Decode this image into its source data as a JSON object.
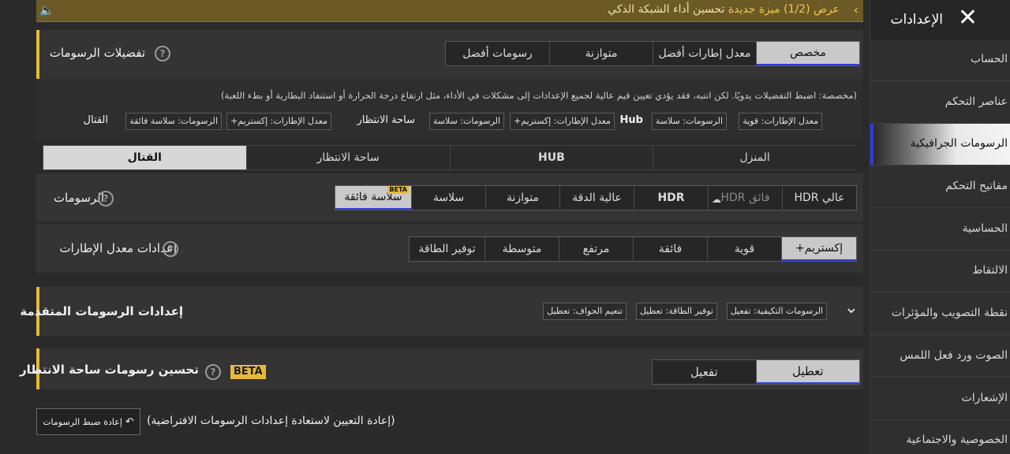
{
  "notice": {
    "speaker_icon": "speaker-icon",
    "text_gold": "عرض (1/2)  ميزة جديدة",
    "text": "تحسين أداء الشبكة الذكي",
    "chevron_icon": "chevron-left-icon"
  },
  "sidebar": {
    "title": "الإعدادات",
    "close_icon": "close-icon",
    "items": [
      {
        "label": "الحساب"
      },
      {
        "label": "عناصر التحكم"
      },
      {
        "label": "الرسومات الجرافيكية"
      },
      {
        "label": "مفاتيح التحكم"
      },
      {
        "label": "الحساسية"
      },
      {
        "label": "الالتقاط"
      },
      {
        "label": "نقطة التصويب والمؤثرات"
      },
      {
        "label": "الصوت ورد فعل اللمس"
      },
      {
        "label": "الإشعارات"
      },
      {
        "label": "الخصوصية والاجتماعية"
      }
    ],
    "active_index": 2
  },
  "prefs": {
    "title": "تفضيلات الرسومات",
    "options": [
      "مخصص",
      "معدل إطارات أفضل",
      "متوازنة",
      "رسومات أفضل"
    ],
    "selected": 0,
    "note": "(مخصصة: اضبط التفضيلات يدويًا. لكن انتبه، فقد يؤدي تعيين قيم عالية لجميع الإعدادات إلى مشكلات في الأداء، مثل ارتفاع درجة الحرارة أو استنفاد البطارية أو بطء اللعبة)",
    "summary": {
      "hub_label": "Hub",
      "hub_fps": "معدل الإطارات: قوية",
      "hub_gfx": "الرسومات: سلاسة",
      "lobby_label": "ساحة الانتظار",
      "lobby_fps": "معدل الإطارات: إكستريم+",
      "lobby_gfx": "الرسومات: سلاسة",
      "combat_label": "القتال",
      "combat_fps": "معدل الإطارات: إكستريم+",
      "combat_gfx": "الرسومات: سلاسة فائقة"
    }
  },
  "mode_tabs": [
    "المنزل",
    "HUB",
    "ساحة الانتظار",
    "القتال"
  ],
  "mode_selected": 3,
  "graphics": {
    "title": "الرسومات",
    "options": [
      "عالي HDR",
      "فائق HDR",
      "HDR",
      "عالية الدقة",
      "متوازنة",
      "سلاسة",
      "سلاسة فائقة"
    ],
    "selected": 6,
    "beta_tag": "BETA",
    "hdr_cloud_icon": "cloud-download-icon"
  },
  "fps": {
    "title": "إعدادات معدل الإطارات",
    "options": [
      "إكستريم+",
      "قوية",
      "فائقة",
      "مرتفع",
      "متوسطة",
      "توفير الطاقة"
    ],
    "selected": 0
  },
  "advanced": {
    "title": "إعدادات الرسومات المتقدمة",
    "chips": [
      "الرسومات التكيفية: تفعيل",
      "توفير الطاقة: تعطيل",
      "تنعيم الحواف: تعطيل"
    ],
    "chevron_icon": "chevron-down-icon"
  },
  "lobby_enhance": {
    "title": "تحسين رسومات ساحة الانتظار",
    "beta": "BETA",
    "options": [
      "تعطيل",
      "تفعيل"
    ],
    "selected": 0
  },
  "reset": {
    "button": "إعادة ضبط الرسومات",
    "icon": "undo-icon",
    "text": "(إعادة التعيين لاستعادة إعدادات الرسومات الافتراضية)"
  },
  "colors": {
    "accent_gold": "#e6b93a",
    "selection_blue": "#2e3bd8"
  }
}
